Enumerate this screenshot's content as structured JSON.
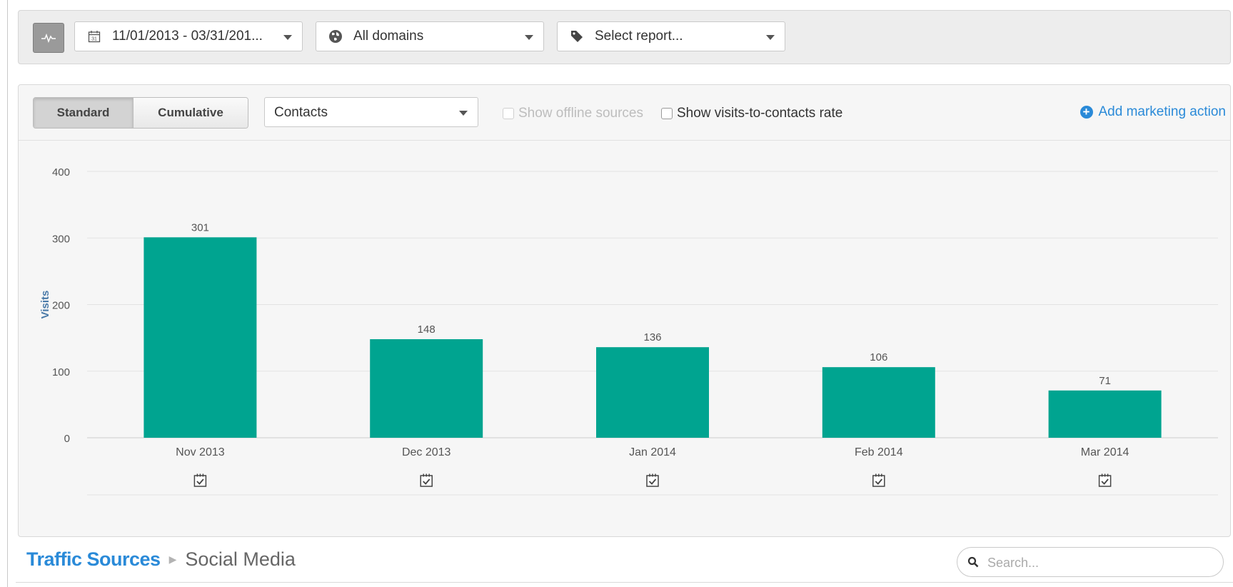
{
  "filters": {
    "date_range": "11/01/2013 - 03/31/201...",
    "domain": "All domains",
    "report": "Select report..."
  },
  "toolbar": {
    "standard_label": "Standard",
    "cumulative_label": "Cumulative",
    "metric": "Contacts",
    "offline_label": "Show offline sources",
    "rate_label": "Show visits-to-contacts rate",
    "add_action_label": "Add marketing action"
  },
  "colors": {
    "bar": "#00a490",
    "link": "#2a8ad8",
    "axis_title": "#4a7aa8"
  },
  "chart_data": {
    "type": "bar",
    "categories": [
      "Nov 2013",
      "Dec 2013",
      "Jan 2014",
      "Feb 2014",
      "Mar 2014"
    ],
    "series": [
      {
        "values": [
          301,
          148,
          136,
          106,
          71
        ]
      }
    ],
    "ylabel": "Visits",
    "ylim": [
      0,
      400
    ],
    "yticks": [
      0,
      100,
      200,
      300,
      400
    ],
    "data_labels": true,
    "grid": true,
    "legend": "none"
  },
  "breadcrumb": {
    "parent": "Traffic Sources",
    "current": "Social Media"
  },
  "search": {
    "placeholder": "Search..."
  },
  "icons": {
    "pulse": "pulse-icon",
    "calendar": "calendar-icon",
    "globe": "globe-icon",
    "tag": "tag-icon",
    "plus": "plus-circle-icon",
    "marker": "marketing-action-icon",
    "search": "search-icon"
  }
}
